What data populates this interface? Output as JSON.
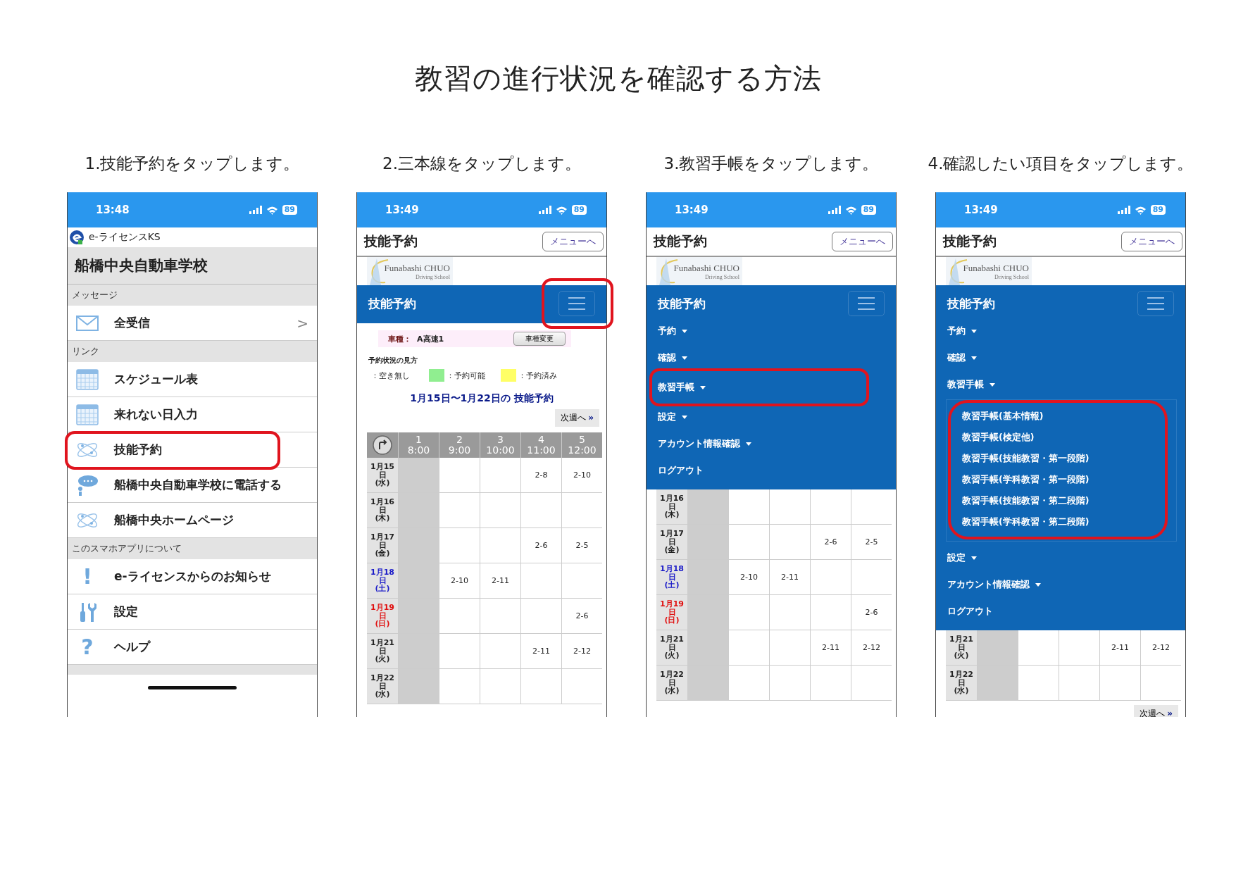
{
  "title": "教習の進行状況を確認する方法",
  "steps": [
    {
      "caption": "1.技能予約をタップします。",
      "screen": {
        "kind": "app_menu",
        "time": "13:48",
        "battery": "89",
        "app_name": "e-ライセンスKS",
        "header": "船橋中央自動車学校",
        "sections": [
          {
            "label": "メッセージ",
            "items": [
              {
                "kind": "mail",
                "label": "全受信",
                "chevron": ">",
                "highlighted": false
              }
            ]
          },
          {
            "label": "リンク",
            "items": [
              {
                "kind": "calendar",
                "label": "スケジュール表",
                "highlighted": false
              },
              {
                "kind": "calendar",
                "label": "来れない日入力",
                "highlighted": false
              },
              {
                "kind": "atom",
                "label": "技能予約",
                "highlighted": true
              },
              {
                "kind": "chat",
                "label": "船橋中央自動車学校に電話する",
                "highlighted": false
              },
              {
                "kind": "atom",
                "label": "船橋中央ホームページ",
                "highlighted": false
              }
            ]
          },
          {
            "label": "このスマホアプリについて",
            "items": [
              {
                "kind": "glyph",
                "glyph": "!",
                "label": "e-ライセンスからのお知らせ",
                "highlighted": false
              },
              {
                "kind": "tools",
                "label": "設定",
                "highlighted": false
              },
              {
                "kind": "glyph",
                "glyph": "?",
                "label": "ヘルプ",
                "highlighted": false
              }
            ]
          }
        ]
      }
    },
    {
      "caption": "2.三本線をタップします。",
      "screen": {
        "kind": "reservation",
        "time": "13:49",
        "battery": "89",
        "page_title": "技能予約",
        "menu_link": "メニューへ",
        "logo": {
          "line1": "Funabashi CHUO",
          "line2": "Driving School"
        },
        "nav": {
          "title": "技能予約",
          "button_highlighted": true
        },
        "car": {
          "label": "車種：",
          "value": "A高速1",
          "button": "車種変更"
        },
        "legend": {
          "title": "予約状況の見方",
          "items": [
            {
              "label": "：空き無し"
            },
            {
              "color": "#90ee90",
              "label": "：予約可能"
            },
            {
              "color": "#ffff66",
              "label": "：予約済み"
            }
          ]
        },
        "week_heading": "1月15日〜1月22日の 技能予約",
        "next_top": {
          "label": "次週へ",
          "mark": "»"
        },
        "table": {
          "columns": [
            {
              "num": "1",
              "time": "8:00"
            },
            {
              "num": "2",
              "time": "9:00"
            },
            {
              "num": "3",
              "time": "10:00"
            },
            {
              "num": "4",
              "time": "11:00"
            },
            {
              "num": "5",
              "time": "12:00"
            }
          ],
          "rows": [
            {
              "date": "1月15日",
              "weekday": "(水)",
              "color": "#222222",
              "cells": [
                {
                  "closed": true
                },
                {
                  "closed": false
                },
                {
                  "closed": false
                },
                {
                  "closed": false,
                  "text": "2-8"
                },
                {
                  "closed": false,
                  "text": "2-10"
                }
              ]
            },
            {
              "date": "1月16日",
              "weekday": "(木)",
              "color": "#222222",
              "cells": [
                {
                  "closed": true
                },
                {
                  "closed": false
                },
                {
                  "closed": false
                },
                {
                  "closed": false
                },
                {
                  "closed": false
                }
              ]
            },
            {
              "date": "1月17日",
              "weekday": "(金)",
              "color": "#222222",
              "cells": [
                {
                  "closed": true
                },
                {
                  "closed": false
                },
                {
                  "closed": false
                },
                {
                  "closed": false,
                  "text": "2-6"
                },
                {
                  "closed": false,
                  "text": "2-5"
                }
              ]
            },
            {
              "date": "1月18日",
              "weekday": "(土)",
              "color": "#1a1ac8",
              "cells": [
                {
                  "closed": true
                },
                {
                  "closed": false,
                  "text": "2-10"
                },
                {
                  "closed": false,
                  "text": "2-11"
                },
                {
                  "closed": false
                },
                {
                  "closed": false
                }
              ]
            },
            {
              "date": "1月19日",
              "weekday": "(日)",
              "color": "#e01010",
              "cells": [
                {
                  "closed": true
                },
                {
                  "closed": false
                },
                {
                  "closed": false
                },
                {
                  "closed": false
                },
                {
                  "closed": false,
                  "text": "2-6"
                }
              ]
            },
            {
              "date": "1月21日",
              "weekday": "(火)",
              "color": "#222222",
              "cells": [
                {
                  "closed": true
                },
                {
                  "closed": false
                },
                {
                  "closed": false
                },
                {
                  "closed": false,
                  "text": "2-11"
                },
                {
                  "closed": false,
                  "text": "2-12"
                }
              ]
            },
            {
              "date": "1月22日",
              "weekday": "(水)",
              "color": "#222222",
              "cells": [
                {
                  "closed": true
                },
                {
                  "closed": false
                },
                {
                  "closed": false
                },
                {
                  "closed": false
                },
                {
                  "closed": false
                }
              ]
            }
          ]
        }
      }
    },
    {
      "caption": "3.教習手帳をタップします。",
      "screen": {
        "kind": "reservation",
        "time": "13:49",
        "battery": "89",
        "page_title": "技能予約",
        "menu_link": "メニューへ",
        "logo": {
          "line1": "Funabashi CHUO",
          "line2": "Driving School"
        },
        "nav": {
          "title": "技能予約",
          "button_highlighted": false,
          "items": [
            {
              "label": "予約",
              "caret": true,
              "highlighted": false
            },
            {
              "label": "確認",
              "caret": true,
              "highlighted": false
            },
            {
              "label": "教習手帳",
              "caret": true,
              "highlighted": true
            },
            {
              "label": "設定",
              "caret": true,
              "highlighted": false
            },
            {
              "label": "アカウント情報確認",
              "caret": true,
              "highlighted": false
            },
            {
              "label": "ログアウト",
              "caret": false,
              "highlighted": false
            }
          ]
        },
        "table": {
          "rows": [
            {
              "date": "1月16日",
              "weekday": "(木)",
              "color": "#222222",
              "cells": [
                {
                  "closed": true
                },
                {
                  "closed": false
                },
                {
                  "closed": false
                },
                {
                  "closed": false
                },
                {
                  "closed": false
                }
              ]
            },
            {
              "date": "1月17日",
              "weekday": "(金)",
              "color": "#222222",
              "cells": [
                {
                  "closed": true
                },
                {
                  "closed": false
                },
                {
                  "closed": false
                },
                {
                  "closed": false,
                  "text": "2-6"
                },
                {
                  "closed": false,
                  "text": "2-5"
                }
              ]
            },
            {
              "date": "1月18日",
              "weekday": "(土)",
              "color": "#1a1ac8",
              "cells": [
                {
                  "closed": true
                },
                {
                  "closed": false,
                  "text": "2-10"
                },
                {
                  "closed": false,
                  "text": "2-11"
                },
                {
                  "closed": false
                },
                {
                  "closed": false
                }
              ]
            },
            {
              "date": "1月19日",
              "weekday": "(日)",
              "color": "#e01010",
              "cells": [
                {
                  "closed": true
                },
                {
                  "closed": false
                },
                {
                  "closed": false
                },
                {
                  "closed": false
                },
                {
                  "closed": false,
                  "text": "2-6"
                }
              ]
            },
            {
              "date": "1月21日",
              "weekday": "(火)",
              "color": "#222222",
              "cells": [
                {
                  "closed": true
                },
                {
                  "closed": false
                },
                {
                  "closed": false
                },
                {
                  "closed": false,
                  "text": "2-11"
                },
                {
                  "closed": false,
                  "text": "2-12"
                }
              ]
            },
            {
              "date": "1月22日",
              "weekday": "(水)",
              "color": "#222222",
              "cells": [
                {
                  "closed": true
                },
                {
                  "closed": false
                },
                {
                  "closed": false
                },
                {
                  "closed": false
                },
                {
                  "closed": false
                }
              ]
            }
          ]
        }
      }
    },
    {
      "caption": "4.確認したい項目をタップします。",
      "screen": {
        "kind": "reservation",
        "time": "13:49",
        "battery": "89",
        "page_title": "技能予約",
        "menu_link": "メニューへ",
        "logo": {
          "line1": "Funabashi CHUO",
          "line2": "Driving School"
        },
        "nav": {
          "title": "技能予約",
          "button_highlighted": false,
          "items": [
            {
              "label": "予約",
              "caret": true,
              "highlighted": false
            },
            {
              "label": "確認",
              "caret": true,
              "highlighted": false
            },
            {
              "label": "教習手帳",
              "caret": true,
              "highlighted": false,
              "submenu_highlighted": true,
              "children": [
                "教習手帳(基本情報)",
                "教習手帳(検定他)",
                "教習手帳(技能教習・第一段階)",
                "教習手帳(学科教習・第一段階)",
                "教習手帳(技能教習・第二段階)",
                "教習手帳(学科教習・第二段階)"
              ]
            },
            {
              "label": "設定",
              "caret": true,
              "highlighted": false
            },
            {
              "label": "アカウント情報確認",
              "caret": true,
              "highlighted": false
            },
            {
              "label": "ログアウト",
              "caret": false,
              "highlighted": false
            }
          ]
        },
        "table": {
          "rows": [
            {
              "date": "1月21日",
              "weekday": "(火)",
              "color": "#222222",
              "cells": [
                {
                  "closed": true
                },
                {
                  "closed": false
                },
                {
                  "closed": false
                },
                {
                  "closed": false,
                  "text": "2-11"
                },
                {
                  "closed": false,
                  "text": "2-12"
                }
              ]
            },
            {
              "date": "1月22日",
              "weekday": "(水)",
              "color": "#222222",
              "cells": [
                {
                  "closed": true
                },
                {
                  "closed": false
                },
                {
                  "closed": false
                },
                {
                  "closed": false
                },
                {
                  "closed": false
                }
              ]
            }
          ]
        },
        "next_bottom": {
          "label": "次週へ",
          "mark": "»"
        }
      }
    }
  ]
}
